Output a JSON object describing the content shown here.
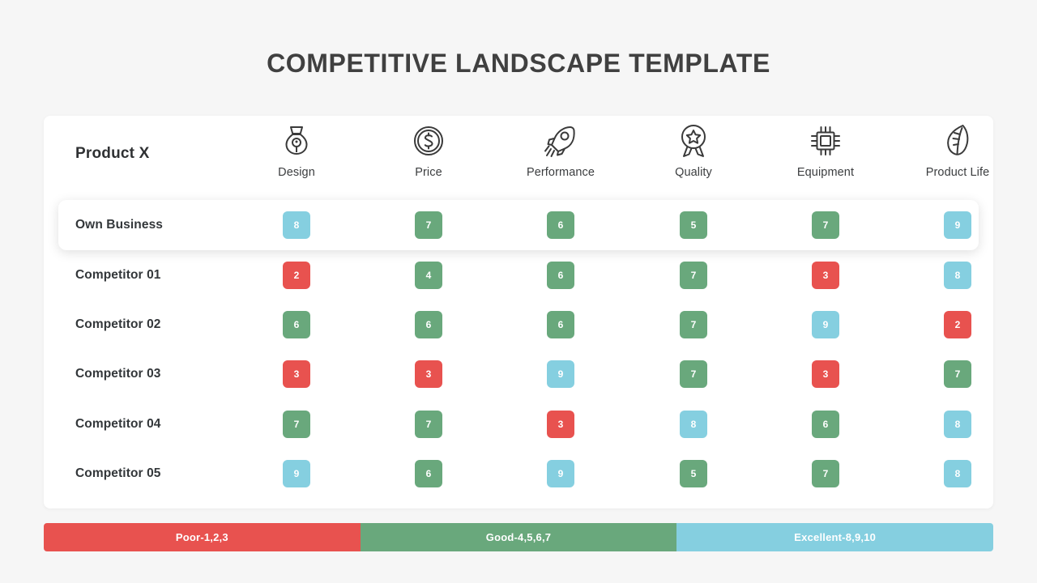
{
  "title": "COMPETITIVE LANDSCAPE TEMPLATE",
  "table": {
    "corner_label": "Product X",
    "columns": [
      {
        "label": "Design",
        "icon": "pen-nib-icon"
      },
      {
        "label": "Price",
        "icon": "dollar-coin-icon"
      },
      {
        "label": "Performance",
        "icon": "rocket-icon"
      },
      {
        "label": "Quality",
        "icon": "award-ribbon-icon"
      },
      {
        "label": "Equipment",
        "icon": "cpu-chip-icon"
      },
      {
        "label": "Product Life",
        "icon": "leaf-icon"
      }
    ],
    "rows": [
      {
        "label": "Own Business",
        "highlight": true,
        "values": [
          8,
          7,
          6,
          5,
          7,
          9
        ]
      },
      {
        "label": "Competitor 01",
        "highlight": false,
        "values": [
          2,
          4,
          6,
          7,
          3,
          8
        ]
      },
      {
        "label": "Competitor 02",
        "highlight": false,
        "values": [
          6,
          6,
          6,
          7,
          9,
          2
        ]
      },
      {
        "label": "Competitor 03",
        "highlight": false,
        "values": [
          3,
          3,
          9,
          7,
          3,
          7
        ]
      },
      {
        "label": "Competitor 04",
        "highlight": false,
        "values": [
          7,
          7,
          3,
          8,
          6,
          8
        ]
      },
      {
        "label": "Competitor 05",
        "highlight": false,
        "values": [
          9,
          6,
          9,
          5,
          7,
          8
        ]
      }
    ]
  },
  "legend": [
    {
      "label": "Poor-1,2,3",
      "color": "#e8524f"
    },
    {
      "label": "Good-4,5,6,7",
      "color": "#69a87c"
    },
    {
      "label": "Excellent-8,9,10",
      "color": "#85cfe0"
    }
  ],
  "colors": {
    "poor": "#e8524f",
    "good": "#69a87c",
    "excellent": "#85cfe0",
    "page_background": "#f6f6f6",
    "card_background": "#ffffff",
    "title_text": "#404040"
  },
  "chart_data": {
    "type": "table",
    "title": "COMPETITIVE LANDSCAPE TEMPLATE",
    "categories": [
      "Design",
      "Price",
      "Performance",
      "Quality",
      "Equipment",
      "Product Life"
    ],
    "series": [
      {
        "name": "Own Business",
        "values": [
          8,
          7,
          6,
          5,
          7,
          9
        ]
      },
      {
        "name": "Competitor 01",
        "values": [
          2,
          4,
          6,
          7,
          3,
          8
        ]
      },
      {
        "name": "Competitor 02",
        "values": [
          6,
          6,
          6,
          7,
          9,
          2
        ]
      },
      {
        "name": "Competitor 03",
        "values": [
          3,
          3,
          9,
          7,
          3,
          7
        ]
      },
      {
        "name": "Competitor 04",
        "values": [
          7,
          7,
          3,
          8,
          6,
          8
        ]
      },
      {
        "name": "Competitor 05",
        "values": [
          9,
          6,
          9,
          5,
          7,
          8
        ]
      }
    ],
    "scale": {
      "min": 1,
      "max": 10
    },
    "legend_position": "bottom"
  }
}
